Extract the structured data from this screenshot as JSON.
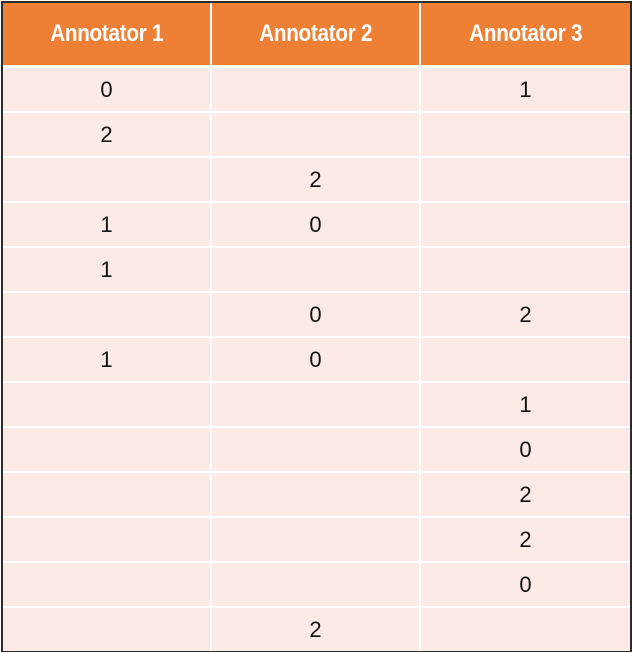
{
  "table": {
    "headers": [
      "Annotator 1",
      "Annotator 2",
      "Annotator 3"
    ],
    "rows": [
      [
        "0",
        "",
        "1"
      ],
      [
        "2",
        "",
        ""
      ],
      [
        "",
        "2",
        ""
      ],
      [
        "1",
        "0",
        ""
      ],
      [
        "1",
        "",
        ""
      ],
      [
        "",
        "0",
        "2"
      ],
      [
        "1",
        "0",
        ""
      ],
      [
        "",
        "",
        "1"
      ],
      [
        "",
        "",
        "0"
      ],
      [
        "",
        "",
        "2"
      ],
      [
        "",
        "",
        "2"
      ],
      [
        "",
        "",
        "0"
      ],
      [
        "",
        "2",
        ""
      ]
    ]
  },
  "colors": {
    "header_bg": "#ee8035",
    "header_text": "#ffffff",
    "cell_bg": "#fbeae5",
    "border": "#2b2b2b"
  }
}
